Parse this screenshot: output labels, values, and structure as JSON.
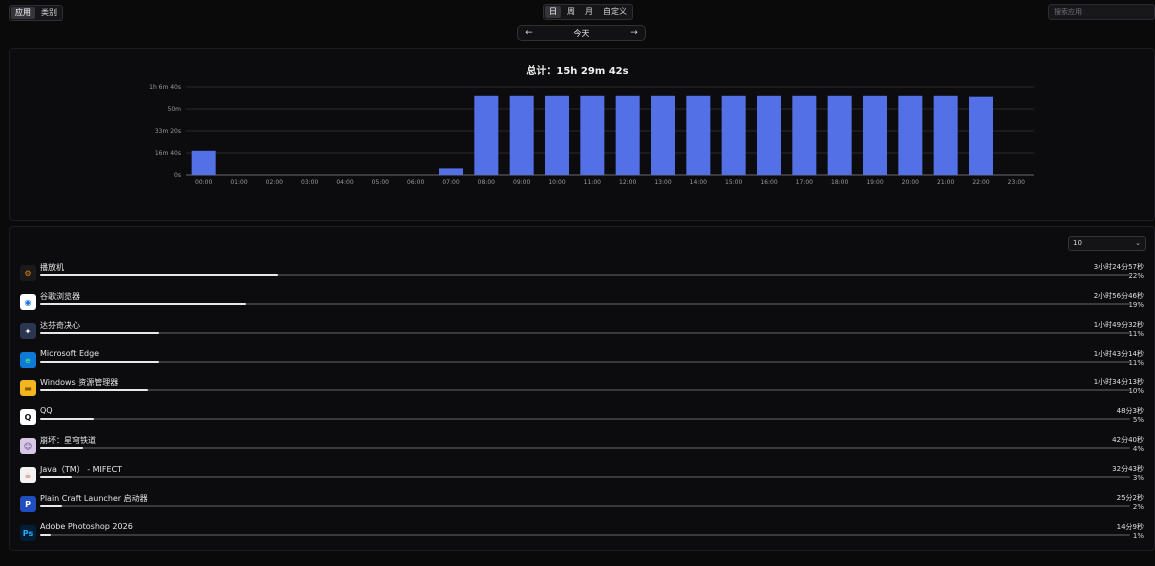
{
  "nav": {
    "left_tabs": [
      {
        "label": "应用",
        "active": true
      },
      {
        "label": "类别",
        "active": false
      }
    ],
    "period_tabs": [
      {
        "label": "日",
        "active": true
      },
      {
        "label": "周",
        "active": false
      },
      {
        "label": "月",
        "active": false
      },
      {
        "label": "自定义",
        "active": false
      }
    ],
    "search_placeholder": "搜索应用"
  },
  "date_nav": {
    "prev_icon": "arrow-left-icon",
    "label": "今天",
    "next_icon": "arrow-right-icon"
  },
  "chart_data": {
    "type": "bar",
    "title": "总计：15h 29m 42s",
    "categories": [
      "00:00",
      "01:00",
      "02:00",
      "03:00",
      "04:00",
      "05:00",
      "06:00",
      "07:00",
      "08:00",
      "09:00",
      "10:00",
      "11:00",
      "12:00",
      "13:00",
      "14:00",
      "15:00",
      "16:00",
      "17:00",
      "18:00",
      "19:00",
      "20:00",
      "21:00",
      "22:00",
      "23:00"
    ],
    "values_seconds": [
      1100,
      0,
      0,
      0,
      0,
      0,
      0,
      300,
      3600,
      3600,
      3600,
      3600,
      3600,
      3600,
      3600,
      3600,
      3600,
      3600,
      3600,
      3600,
      3600,
      3600,
      3560,
      0
    ],
    "y_ticks": [
      {
        "value": 0,
        "label": "0s"
      },
      {
        "value": 1000,
        "label": "16m 40s"
      },
      {
        "value": 2000,
        "label": "33m 20s"
      },
      {
        "value": 3000,
        "label": "50m"
      },
      {
        "value": 4000,
        "label": "1h 6m 40s"
      }
    ],
    "ylim": [
      0,
      4000
    ],
    "grid": true,
    "bar_color": "#5470e6"
  },
  "list": {
    "limit_value": "10",
    "limit_icon": "chevron-down-icon",
    "apps": [
      {
        "name": "播放机",
        "duration": "3小时24分57秒",
        "percent": 22,
        "percent_label": "22%",
        "icon": "blender-icon",
        "icon_bg": "#1a1a1a",
        "icon_fg": "#e87d0d",
        "icon_glyph": "⚙"
      },
      {
        "name": "谷歌浏览器",
        "duration": "2小时56分46秒",
        "percent": 19,
        "percent_label": "19%",
        "icon": "chrome-icon",
        "icon_bg": "#ffffff",
        "icon_fg": "#1a73e8",
        "icon_glyph": "◉"
      },
      {
        "name": "达芬奇决心",
        "duration": "1小时49分32秒",
        "percent": 11,
        "percent_label": "11%",
        "icon": "davinci-resolve-icon",
        "icon_bg": "#2a3550",
        "icon_fg": "#ffffff",
        "icon_glyph": "✦"
      },
      {
        "name": "Microsoft Edge",
        "duration": "1小时43分14秒",
        "percent": 11,
        "percent_label": "11%",
        "icon": "edge-icon",
        "icon_bg": "#0c7ad6",
        "icon_fg": "#3fd48a",
        "icon_glyph": "e"
      },
      {
        "name": "Windows 资源管理器",
        "duration": "1小时34分13秒",
        "percent": 10,
        "percent_label": "10%",
        "icon": "folder-icon",
        "icon_bg": "#f2b61f",
        "icon_fg": "#8a5a00",
        "icon_glyph": "▬"
      },
      {
        "name": "QQ",
        "duration": "48分3秒",
        "percent": 5,
        "percent_label": "5%",
        "icon": "qq-icon",
        "icon_bg": "#ffffff",
        "icon_fg": "#111111",
        "icon_glyph": "Q"
      },
      {
        "name": "崩坏：星穹铁道",
        "duration": "42分40秒",
        "percent": 4,
        "percent_label": "4%",
        "icon": "game-avatar-icon",
        "icon_bg": "#d9c7e8",
        "icon_fg": "#4a3b6b",
        "icon_glyph": "☺"
      },
      {
        "name": "Java（TM） - MIFECT",
        "duration": "32分43秒",
        "percent": 3,
        "percent_label": "3%",
        "icon": "java-icon",
        "icon_bg": "#f2f2f2",
        "icon_fg": "#d2492a",
        "icon_glyph": "☕"
      },
      {
        "name": "Plain Craft Launcher 启动器",
        "duration": "25分2秒",
        "percent": 2,
        "percent_label": "2%",
        "icon": "pcl-icon",
        "icon_bg": "#1f4fbf",
        "icon_fg": "#ffffff",
        "icon_glyph": "P"
      },
      {
        "name": "Adobe Photoshop 2026",
        "duration": "14分9秒",
        "percent": 1,
        "percent_label": "1%",
        "icon": "photoshop-icon",
        "icon_bg": "#001e36",
        "icon_fg": "#31a8ff",
        "icon_glyph": "Ps"
      }
    ]
  }
}
